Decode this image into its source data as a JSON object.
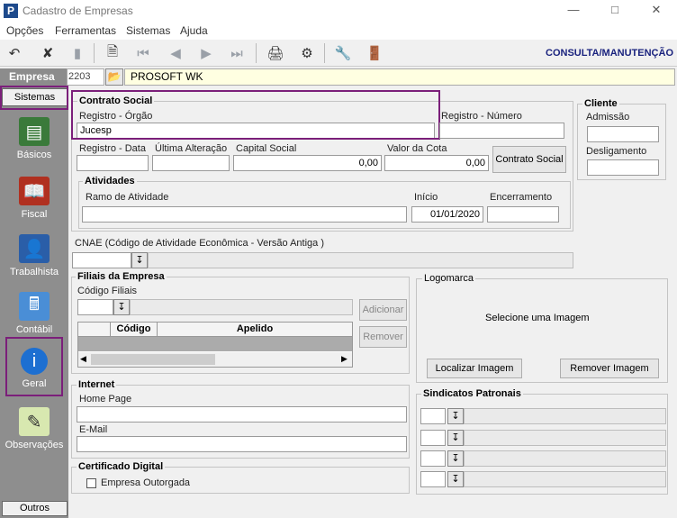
{
  "window": {
    "title": "Cadastro de Empresas",
    "logo": "P"
  },
  "menu": [
    "Opções",
    "Ferramentas",
    "Sistemas",
    "Ajuda"
  ],
  "toolbar": {
    "mode": "CONSULTA/MANUTENÇÃO"
  },
  "empresa": {
    "label": "Empresa",
    "code": "2203",
    "name": "PROSOFT WK"
  },
  "sidebar": {
    "top_button": "Sistemas",
    "items": [
      "Básicos",
      "Fiscal",
      "Trabalhista",
      "Contábil",
      "Geral",
      "Observações"
    ],
    "bottom_button": "Outros"
  },
  "contrato": {
    "title": "Contrato Social",
    "registro_orgao_label": "Registro - Órgão",
    "registro_orgao_value": "Jucesp",
    "registro_numero_label": "Registro - Número",
    "registro_data_label": "Registro - Data",
    "ultima_alteracao_label": "Última Alteração",
    "capital_label": "Capital Social",
    "capital_value": "0,00",
    "valor_cota_label": "Valor da Cota",
    "valor_cota_value": "0,00",
    "contrato_button": "Contrato Social"
  },
  "atividades": {
    "title": "Atividades",
    "ramo_label": "Ramo de Atividade",
    "inicio_label": "Início",
    "inicio_value": "01/01/2020",
    "encerramento_label": "Encerramento"
  },
  "cliente": {
    "title": "Cliente",
    "admissao_label": "Admissão",
    "desligamento_label": "Desligamento"
  },
  "cnae": {
    "label": "CNAE (Código de Atividade Econômica - Versão Antiga )"
  },
  "filiais": {
    "title": "Filiais da Empresa",
    "codigo_label": "Código Filiais",
    "columns": [
      "Código",
      "Apelido"
    ],
    "add_button": "Adicionar",
    "remove_button": "Remover"
  },
  "logomarca": {
    "title": "Logomarca",
    "placeholder": "Selecione  uma  Imagem",
    "localizar_button": "Localizar Imagem",
    "remover_button": "Remover Imagem"
  },
  "internet": {
    "title": "Internet",
    "home_label": "Home Page",
    "email_label": "E-Mail"
  },
  "sindicatos": {
    "title": "Sindicatos Patronais"
  },
  "certificado": {
    "title": "Certificado Digital",
    "checkbox_label": "Empresa Outorgada"
  }
}
